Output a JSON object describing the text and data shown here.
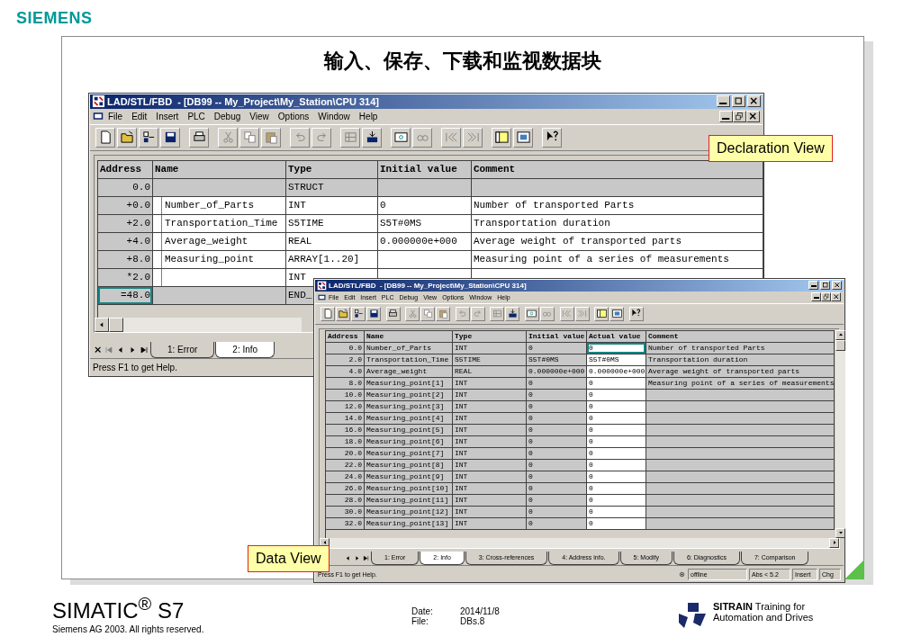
{
  "brand": "SIEMENS",
  "slide_title": "输入、保存、下载和监视数据块",
  "declaration_window": {
    "title": "LAD/STL/FBD  - [DB99 -- My_Project\\My_Station\\CPU 314]",
    "menu": [
      "File",
      "Edit",
      "Insert",
      "PLC",
      "Debug",
      "View",
      "Options",
      "Window",
      "Help"
    ],
    "columns": [
      "Address",
      "Name",
      "Type",
      "Initial value",
      "Comment"
    ],
    "rows": [
      {
        "kind": "struct",
        "address": "0.0",
        "type": "STRUCT",
        "selected": false
      },
      {
        "kind": "element",
        "address": "+0.0",
        "name": "Number_of_Parts",
        "type": "INT",
        "initial_value": "0",
        "comment": "Number of transported Parts",
        "selected": false
      },
      {
        "kind": "element",
        "address": "+2.0",
        "name": "Transportation_Time",
        "type": "S5TIME",
        "initial_value": "S5T#0MS",
        "comment": "Transportation duration",
        "selected": false
      },
      {
        "kind": "element",
        "address": "+4.0",
        "name": "Average_weight",
        "type": "REAL",
        "initial_value": "0.000000e+000",
        "comment": "Average weight of transported parts",
        "selected": false
      },
      {
        "kind": "element",
        "address": "+8.0",
        "name": "Measuring_point",
        "type": "ARRAY[1..20]",
        "comment": "Measuring point of a series of measurements",
        "selected": false
      },
      {
        "kind": "element",
        "address": "*2.0",
        "type": "INT",
        "selected": false
      },
      {
        "kind": "struct",
        "address": "=48.0",
        "type": "END_",
        "selected": true
      }
    ],
    "tabs": [
      {
        "label": "1: Error",
        "selected": false
      },
      {
        "label": "2: Info",
        "selected": true
      }
    ],
    "status": "Press F1 to get Help."
  },
  "data_window": {
    "title": "LAD/STL/FBD  - [DB99 -- My_Project\\My_Station\\CPU 314]",
    "menu": [
      "File",
      "Edit",
      "Insert",
      "PLC",
      "Debug",
      "View",
      "Options",
      "Window",
      "Help"
    ],
    "columns": [
      "Address",
      "Name",
      "Type",
      "Initial value",
      "Actual value",
      "Comment"
    ],
    "rows": [
      {
        "address": "0.0",
        "name": "Number_of_Parts",
        "type": "INT",
        "initial_value": "0",
        "actual_value": "0",
        "comment": "Number of transported Parts",
        "selected": true
      },
      {
        "address": "2.0",
        "name": "Transportation_Time",
        "type": "S5TIME",
        "initial_value": "S5T#0MS",
        "actual_value": "S5T#0MS",
        "comment": "Transportation duration",
        "selected": false
      },
      {
        "address": "4.0",
        "name": "Average_weight",
        "type": "REAL",
        "initial_value": "0.000000e+000",
        "actual_value": "0.000000e+000",
        "comment": "Average weight of transported parts",
        "selected": false
      },
      {
        "address": "8.0",
        "name": "Measuring_point[1]",
        "type": "INT",
        "initial_value": "0",
        "actual_value": "0",
        "comment": "Measuring point of a series of measurements",
        "selected": false
      },
      {
        "address": "10.0",
        "name": "Measuring_point[2]",
        "type": "INT",
        "initial_value": "0",
        "actual_value": "0",
        "selected": false
      },
      {
        "address": "12.0",
        "name": "Measuring_point[3]",
        "type": "INT",
        "initial_value": "0",
        "actual_value": "0",
        "selected": false
      },
      {
        "address": "14.0",
        "name": "Measuring_point[4]",
        "type": "INT",
        "initial_value": "0",
        "actual_value": "0",
        "selected": false
      },
      {
        "address": "16.0",
        "name": "Measuring_point[5]",
        "type": "INT",
        "initial_value": "0",
        "actual_value": "0",
        "selected": false
      },
      {
        "address": "18.0",
        "name": "Measuring_point[6]",
        "type": "INT",
        "initial_value": "0",
        "actual_value": "0",
        "selected": false
      },
      {
        "address": "20.0",
        "name": "Measuring_point[7]",
        "type": "INT",
        "initial_value": "0",
        "actual_value": "0",
        "selected": false
      },
      {
        "address": "22.0",
        "name": "Measuring_point[8]",
        "type": "INT",
        "initial_value": "0",
        "actual_value": "0",
        "selected": false
      },
      {
        "address": "24.0",
        "name": "Measuring_point[9]",
        "type": "INT",
        "initial_value": "0",
        "actual_value": "0",
        "selected": false
      },
      {
        "address": "26.0",
        "name": "Measuring_point[10]",
        "type": "INT",
        "initial_value": "0",
        "actual_value": "0",
        "selected": false
      },
      {
        "address": "28.0",
        "name": "Measuring_point[11]",
        "type": "INT",
        "initial_value": "0",
        "actual_value": "0",
        "selected": false
      },
      {
        "address": "30.0",
        "name": "Measuring_point[12]",
        "type": "INT",
        "initial_value": "0",
        "actual_value": "0",
        "selected": false
      },
      {
        "address": "32.0",
        "name": "Measuring_point[13]",
        "type": "INT",
        "initial_value": "0",
        "actual_value": "0",
        "selected": false
      }
    ],
    "tabs": [
      {
        "label": "1: Error",
        "selected": false
      },
      {
        "label": "2: Info",
        "selected": true
      },
      {
        "label": "3: Cross-references",
        "selected": false
      },
      {
        "label": "4: Address info.",
        "selected": false
      },
      {
        "label": "5: Modify",
        "selected": false
      },
      {
        "label": "6: Diagnostics",
        "selected": false
      },
      {
        "label": "7: Comparison",
        "selected": false
      }
    ],
    "status": "Press F1 to get Help.",
    "status_fields": [
      "offline",
      "Abs < 5.2",
      "Insert",
      "Chg"
    ]
  },
  "callouts": [
    "Declaration View",
    "Data View"
  ],
  "footer": {
    "product": "SIMATIC$^{®}$ S7",
    "copyright": "Siemens AG 2003. All rights reserved.",
    "date_label": "Date:",
    "date": "2014/11/8",
    "file_label": "File:",
    "file": "DBs.8",
    "sitrain_line1": "**SITRAIN** Training for",
    "sitrain_line2": "Automation and Drives"
  }
}
